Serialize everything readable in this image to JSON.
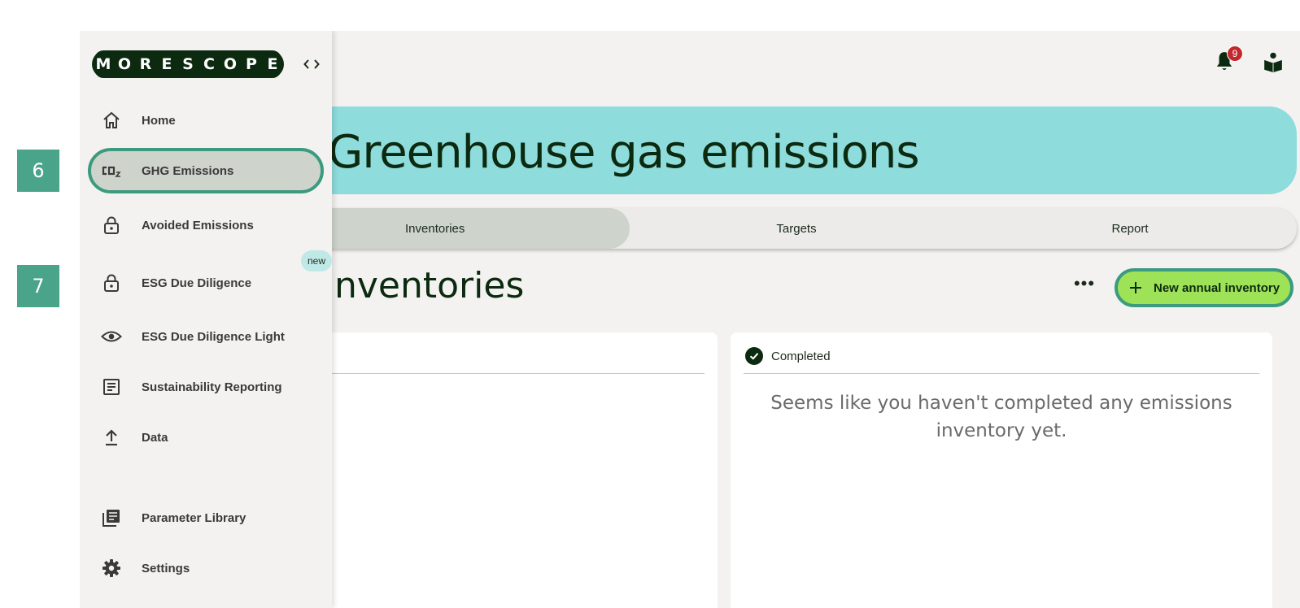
{
  "steps": [
    "6",
    "7"
  ],
  "topbar": {
    "notification_count": "9"
  },
  "hero": {
    "title": "Greenhouse gas emissions"
  },
  "tabs": [
    {
      "label": "Inventories",
      "active": true
    },
    {
      "label": "Targets",
      "active": false
    },
    {
      "label": "Report",
      "active": false
    }
  ],
  "section": {
    "title": "Inventories",
    "more_label": "•••",
    "new_button_label": "New annual inventory"
  },
  "cards": {
    "left": {
      "header": ""
    },
    "right": {
      "header": "Completed",
      "empty_message": "Seems like you haven't completed any emissions inventory yet."
    }
  },
  "sidebar": {
    "logo_letters": [
      "M",
      "O",
      "R",
      "E",
      "S",
      "C",
      "O",
      "P",
      "E"
    ],
    "collapse_icon": "chevrons-left-right",
    "items": [
      {
        "label": "Home",
        "icon": "home-icon"
      },
      {
        "label": "GHG Emissions",
        "icon": "co2-icon",
        "selected": true
      },
      {
        "label": "Avoided Emissions",
        "icon": "lock-icon"
      },
      {
        "label": "ESG Due Diligence",
        "icon": "lock-icon",
        "badge": "new"
      },
      {
        "label": "ESG Due Diligence Light",
        "icon": "eye-icon"
      },
      {
        "label": "Sustainability Reporting",
        "icon": "document-icon"
      },
      {
        "label": "Data",
        "icon": "upload-icon"
      },
      {
        "label": "Parameter Library",
        "icon": "library-icon"
      },
      {
        "label": "Settings",
        "icon": "gear-icon"
      }
    ]
  },
  "colors": {
    "accent_teal": "#8fdcdc",
    "accent_green": "#9ee357",
    "focus_ring": "#3c9a7f",
    "dark_text": "#0c2a10"
  }
}
